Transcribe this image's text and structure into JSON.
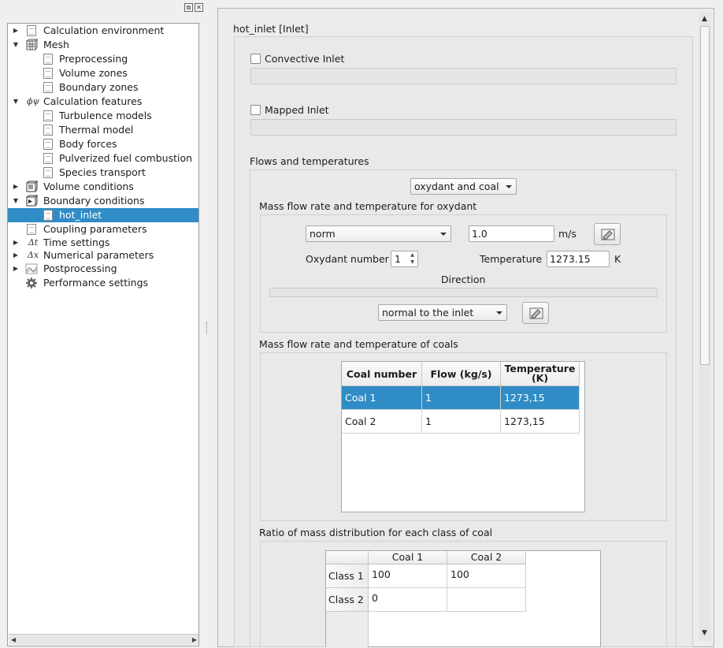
{
  "tree": {
    "items": [
      {
        "label": "Calculation environment",
        "icon": "document-icon",
        "expanded": false
      },
      {
        "label": "Mesh",
        "icon": "mesh-icon",
        "expanded": true
      },
      {
        "label": "Preprocessing",
        "icon": "document-icon"
      },
      {
        "label": "Volume zones",
        "icon": "document-icon"
      },
      {
        "label": "Boundary zones",
        "icon": "document-icon"
      },
      {
        "label": "Calculation features",
        "icon": "phi-psi-icon",
        "glyph": "ϕψ",
        "expanded": true
      },
      {
        "label": "Turbulence models",
        "icon": "document-icon"
      },
      {
        "label": "Thermal model",
        "icon": "document-icon"
      },
      {
        "label": "Body forces",
        "icon": "document-icon"
      },
      {
        "label": "Pulverized fuel combustion",
        "icon": "document-icon"
      },
      {
        "label": "Species transport",
        "icon": "document-icon"
      },
      {
        "label": "Volume conditions",
        "icon": "volume-icon",
        "expanded": false
      },
      {
        "label": "Boundary conditions",
        "icon": "boundary-icon",
        "expanded": true
      },
      {
        "label": "hot_inlet",
        "icon": "document-icon",
        "selected": true
      },
      {
        "label": "Coupling parameters",
        "icon": "document-icon"
      },
      {
        "label": "Time settings",
        "icon": "delta-t-icon",
        "glyph": "Δt",
        "expanded": false
      },
      {
        "label": "Numerical parameters",
        "icon": "delta-x-icon",
        "glyph": "Δx",
        "expanded": false
      },
      {
        "label": "Postprocessing",
        "icon": "graph-icon",
        "expanded": false
      },
      {
        "label": "Performance settings",
        "icon": "gear-icon"
      }
    ]
  },
  "panel": {
    "title": "hot_inlet [Inlet]",
    "convective_inlet_label": "Convective Inlet",
    "convective_inlet_checked": false,
    "mapped_inlet_label": "Mapped Inlet",
    "mapped_inlet_checked": false,
    "flows_title": "Flows and temperatures",
    "mode_combo": "oxydant and coal",
    "oxydant_title": "Mass flow rate and temperature for oxydant",
    "norm_combo": "norm",
    "velocity_value": "1.0",
    "velocity_unit": "m/s",
    "oxydant_number_label": "Oxydant number",
    "oxydant_number": "1",
    "temperature_label": "Temperature",
    "temperature_value": "1273.15",
    "temperature_unit": "K",
    "direction_label": "Direction",
    "direction_combo": "normal to the inlet",
    "coals_title": "Mass flow rate and temperature of coals",
    "coal_table": {
      "headers": [
        "Coal number",
        "Flow (kg/s)",
        "Temperature\n(K)"
      ],
      "rows": [
        [
          "Coal  1",
          "1",
          "1273,15"
        ],
        [
          "Coal  2",
          "1",
          "1273,15"
        ]
      ],
      "selected_row": 0
    },
    "ratio_title": "Ratio of mass distribution for each class of coal",
    "ratio_table": {
      "headers": [
        "Coal 1",
        "Coal 2"
      ],
      "row_headers": [
        "Class 1",
        "Class 2"
      ],
      "rows": [
        [
          "100",
          "100"
        ],
        [
          "0",
          ""
        ]
      ]
    }
  },
  "colors": {
    "selection": "#308cc6",
    "background": "#efefef"
  }
}
